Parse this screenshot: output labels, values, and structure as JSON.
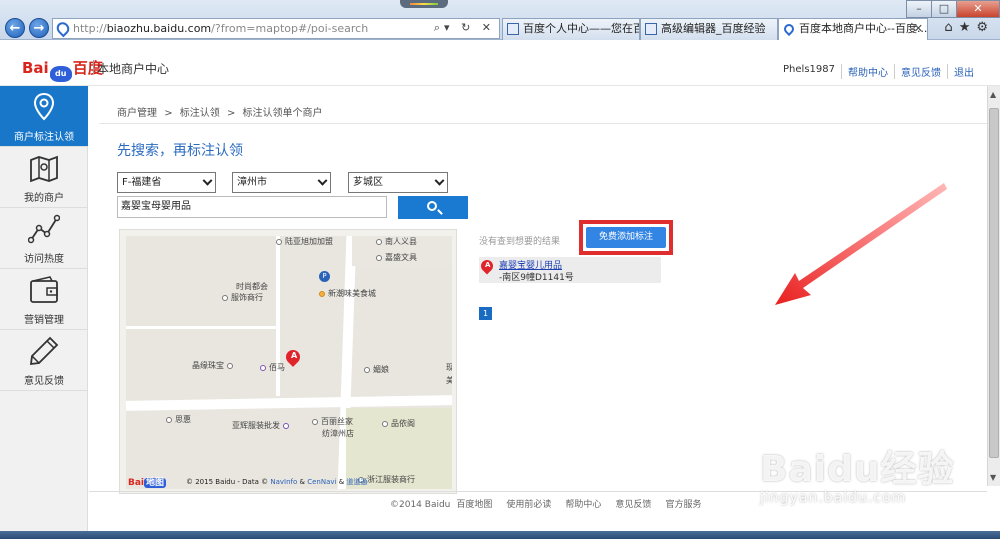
{
  "browser": {
    "address_url_prefix": "http://",
    "address_url_host": "biaozhu.baidu.com",
    "address_url_path": "/?from=maptop#/poi-search",
    "tabs": [
      {
        "label": "百度个人中心——您在百度..."
      },
      {
        "label": "高级编辑器_百度经验"
      },
      {
        "label": "百度本地商户中心--百度...",
        "active": true
      }
    ]
  },
  "header": {
    "logo_text_1": "Bai",
    "logo_paw_text": "du",
    "logo_text_2": "百度",
    "site_name": "本地商户中心",
    "username": "Phels1987",
    "links": [
      "帮助中心",
      "意见反馈",
      "退出"
    ]
  },
  "sidebar": {
    "items": [
      {
        "label": "商户标注认领",
        "icon": "map-pin-icon",
        "active": true
      },
      {
        "label": "我的商户",
        "icon": "map-icon"
      },
      {
        "label": "访问热度",
        "icon": "line-chart-icon"
      },
      {
        "label": "营销管理",
        "icon": "wallet-icon"
      },
      {
        "label": "意见反馈",
        "icon": "pencil-icon"
      }
    ]
  },
  "breadcrumb": [
    "商户管理",
    ">",
    "标注认领",
    ">",
    "标注认领单个商户"
  ],
  "page_title": "先搜索，再标注认领",
  "filters": {
    "province": "F-福建省",
    "city": "漳州市",
    "district": "芗城区"
  },
  "search": {
    "value": "嘉婴宝母婴用品"
  },
  "map": {
    "pois": [
      "陆亚旭加加盟",
      "南人义县",
      "嘉盛文具",
      "时尚都会",
      "服饰商行",
      "新潮味美食城",
      "晶缘珠宝",
      "佰马",
      "媚娘",
      "现",
      "美",
      "思惠",
      "亚辉服装批发",
      "百丽丝家",
      "纺漳州店",
      "品依阁",
      "浙江服装商行"
    ],
    "parking_label": "P",
    "pin_label": "A",
    "logo_text": "Bai",
    "logo_badge": "地图",
    "copyright_prefix": "© 2015 Baidu - Data ©",
    "copyright_navinfo": "NavInfo",
    "copyright_amp": "&",
    "copyright_cennavi": "CenNavi",
    "copyright_amp2": "&",
    "copyright_daotong": "道道通"
  },
  "results": {
    "no_result_text": "没有查到想要的结果",
    "add_button_label": "免费添加标注",
    "items": [
      {
        "pin": "A",
        "name": "嘉婴宝婴儿用品",
        "address": "-南区9幢D1141号"
      }
    ],
    "current_page": "1"
  },
  "footer": [
    "©2014 Baidu",
    "百度地图",
    "使用前必读",
    "帮助中心",
    "意见反馈",
    "官方服务"
  ],
  "watermark": {
    "line1": "Baidu经验",
    "line2": "jingyan.baidu.com"
  },
  "colors": {
    "accent_blue": "#1977c9",
    "button_blue": "#3385e3",
    "highlight_red": "#e02d2d",
    "brand_red": "#d9261c"
  }
}
